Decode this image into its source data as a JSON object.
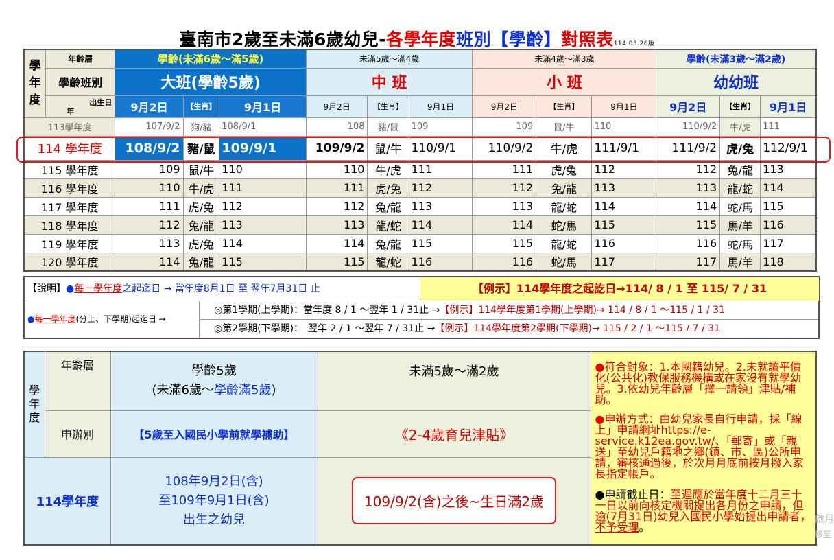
{
  "title": {
    "part1": "臺南市2歲至未滿6歲幼兒-",
    "part2": "各學年度",
    "part3": "班別【學齡】",
    "part4": "對照表",
    "version": "114.05.26版"
  },
  "table1": {
    "corner": [
      "學",
      "年",
      "度"
    ],
    "age_layer_label": "年齡層",
    "class_label": "學齡班別",
    "birth_label": "出生日",
    "year_label": "年",
    "col_groups": [
      {
        "age": "學齡(未滿6歲～滿5歲)",
        "class": "大班(學齡5歲)"
      },
      {
        "age": "未滿5歲～滿4歲",
        "class": "中 班"
      },
      {
        "age": "未滿4歲～滿3歲",
        "class": "小 班"
      },
      {
        "age": "學齡(未滿3歲～滿2歲)",
        "class": "幼幼班"
      }
    ],
    "sub_headers": [
      "9月2日",
      "【生肖】",
      "9月1日"
    ],
    "rows": [
      {
        "year": "113學年度",
        "cells": [
          "107/9/2",
          "狗/豬",
          "108/9/1",
          "108",
          "豬/鼠",
          "109",
          "109",
          "鼠/牛",
          "110",
          "110/9/2",
          "牛/虎",
          "111"
        ]
      },
      {
        "year": "114 學年度",
        "cells": [
          "108/9/2",
          "豬/鼠",
          "109/9/1",
          "109/9/2",
          "鼠/牛",
          "110/9/1",
          "110/9/2",
          "牛/虎",
          "111/9/1",
          "111/9/2",
          "虎/兔",
          "112/9/1"
        ]
      },
      {
        "year": "115 學年度",
        "cells": [
          "109",
          "鼠/牛",
          "110",
          "110",
          "牛/虎",
          "111",
          "111",
          "虎/兔",
          "112",
          "112",
          "兔/龍",
          "113"
        ]
      },
      {
        "year": "116 學年度",
        "cells": [
          "110",
          "牛/虎",
          "111",
          "111",
          "虎/兔",
          "112",
          "112",
          "兔/龍",
          "113",
          "113",
          "龍/蛇",
          "114"
        ]
      },
      {
        "year": "117 學年度",
        "cells": [
          "111",
          "虎/兔",
          "112",
          "112",
          "兔/龍",
          "113",
          "113",
          "龍/蛇",
          "114",
          "114",
          "蛇/馬",
          "115"
        ]
      },
      {
        "year": "118 學年度",
        "cells": [
          "112",
          "兔/龍",
          "113",
          "113",
          "龍/蛇",
          "114",
          "114",
          "蛇/馬",
          "115",
          "115",
          "馬/羊",
          "116"
        ]
      },
      {
        "year": "119 學年度",
        "cells": [
          "113",
          "虎/兔",
          "114",
          "114",
          "兔/龍",
          "115",
          "115",
          "龍/蛇",
          "116",
          "116",
          "蛇/馬",
          "117"
        ]
      },
      {
        "year": "120 學年度",
        "cells": [
          "114",
          "兔/龍",
          "115",
          "115",
          "龍/蛇",
          "116",
          "116",
          "蛇/馬",
          "117",
          "117",
          "馬/羊",
          "118"
        ]
      }
    ]
  },
  "notes": {
    "line1_prefix": "【說明】",
    "line1_link": "每一學年度",
    "line1_rest": "之起迄日 → 當年度8月1日 至 翌年7月31日 止",
    "line1_example": "【例示】114學年度之起訖日→114/ 8 / 1 至 115/ 7 / 31",
    "line2_left_link": "每一學年度",
    "line2_left_rest": "(分上、下學期)起迄日 →",
    "sem1": "◎第1學期(上學期)：當年度 8 / 1 ～翌年 1 / 31止 →",
    "sem1_example": "【例示】114學年度第1學期(上學期)→ 114 / 8 / 1 ～115 / 1 / 31",
    "sem2": "◎第2學期(下學期)：　翌年 2 / 1 ～翌年 7 / 31止 →",
    "sem2_example": "【例示】114學年度第2學期(下學期)→ 115 / 2 / 1 ～115 / 7 / 31"
  },
  "table2": {
    "corner": "學年度",
    "age_label": "年齡層",
    "age5_line1": "學齡5歲",
    "age5_line2a": "(未滿6歲～",
    "age5_line2b": "學齡滿5歲",
    "age5_line2c": ")",
    "age24": "未滿5歲～滿2歲",
    "apply_label": "申辦別",
    "apply5": "【5歲至入國民小學前就學補助】",
    "apply24": "《2-4歲育兒津貼》",
    "year_label": "114學年度",
    "range5_l1": "108年9月2日(含)",
    "range5_l2": "至109年9月1日(含)",
    "range5_l3": "出生之幼兒",
    "range24": "109/9/2(含)之後~生日滿2歲",
    "info1": "●符合對象：1.本國籍幼兒。2.未就讀平價化(公共化)教保服務機構或在家沒有就學幼兒。3.依幼兒年齡層「擇一請領」津貼/補助。",
    "info2": "●申辦方式：由幼兒家長自行申請，採「線上」申請網址https://e-service.k12ea.gov.tw/、「郵寄」或「親送」至幼兒戶籍地之鄉(鎮、市、區)公所申請，審核通過後，於次月月底前按月撥入家長指定帳戶。",
    "info3a": "●申請截止日：",
    "info3b": "至遲應於當年度十二月三十一日以前向核定機關提出各月份之申請，但逾(7月31日)幼兒入國民小學始提出申請者，",
    "info3c": "不予受理",
    "info3d": "。"
  },
  "watermark": [
    "啟月",
    "移至"
  ]
}
